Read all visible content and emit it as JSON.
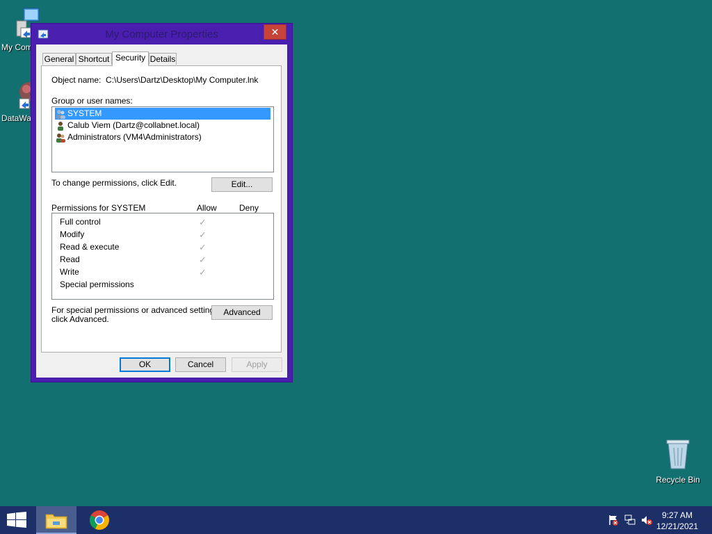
{
  "desktop": {
    "icons": [
      {
        "label": "My Com",
        "icon": "computer-icon"
      },
      {
        "label": "DataWa",
        "icon": "datawave-icon"
      },
      {
        "label": "Recycle Bin",
        "icon": "recycle-bin-icon"
      }
    ]
  },
  "window": {
    "title": "My Computer Properties",
    "close_label": "✕",
    "tabs": [
      "General",
      "Shortcut",
      "Security",
      "Details"
    ],
    "active_tab": "Security",
    "object_name_label": "Object name:",
    "object_name_value": "C:\\Users\\Dartz\\Desktop\\My Computer.lnk",
    "group_label": "Group or user names:",
    "users": [
      {
        "name": "SYSTEM",
        "selected": true
      },
      {
        "name": "Calub Viem (Dartz@collabnet.local)",
        "selected": false
      },
      {
        "name": "Administrators (VM4\\Administrators)",
        "selected": false
      }
    ],
    "change_text": "To change permissions, click Edit.",
    "edit_button": "Edit...",
    "permissions_for": "Permissions for SYSTEM",
    "allow_header": "Allow",
    "deny_header": "Deny",
    "permissions": [
      {
        "name": "Full control",
        "allow": true,
        "deny": false
      },
      {
        "name": "Modify",
        "allow": true,
        "deny": false
      },
      {
        "name": "Read & execute",
        "allow": true,
        "deny": false
      },
      {
        "name": "Read",
        "allow": true,
        "deny": false
      },
      {
        "name": "Write",
        "allow": true,
        "deny": false
      },
      {
        "name": "Special permissions",
        "allow": false,
        "deny": false
      }
    ],
    "advanced_text_1": "For special permissions or advanced settings,",
    "advanced_text_2": "click Advanced.",
    "advanced_button": "Advanced",
    "ok_button": "OK",
    "cancel_button": "Cancel",
    "apply_button": "Apply"
  },
  "taskbar": {
    "time": "9:27 AM",
    "date": "12/21/2021",
    "items": [
      "file-explorer-icon",
      "chrome-icon"
    ]
  }
}
